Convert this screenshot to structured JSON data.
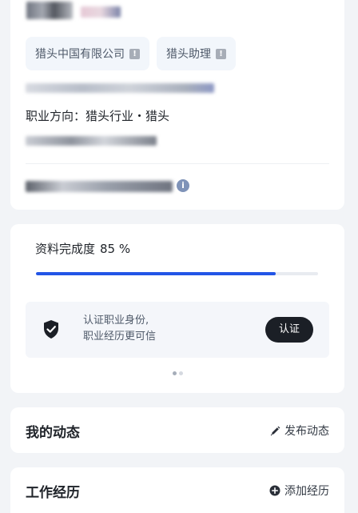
{
  "profile": {
    "tags": [
      {
        "label": "猎头中国有限公司",
        "badge": "!"
      },
      {
        "label": "猎头助理",
        "badge": "!"
      }
    ],
    "career_direction": "职业方向：猎头行业・猎头",
    "info_icon": "i"
  },
  "completion": {
    "label": "资料完成度",
    "percent_text": "85 %",
    "percent": 85
  },
  "verify": {
    "line1": "认证职业身份,",
    "line2": "职业经历更可信",
    "button_label": "认证",
    "pager_total": 2,
    "pager_active": 0
  },
  "moments": {
    "title": "我的动态",
    "action_label": "发布动态"
  },
  "experience": {
    "title": "工作经历",
    "action_label": "添加经历"
  },
  "colors": {
    "accent": "#2255e6",
    "dark_button": "#1b1f26",
    "page_bg": "#f2f4f7"
  },
  "icons": {
    "tag_badge": "warning-badge-icon",
    "info": "info-icon",
    "shield": "shield-check-icon",
    "publish": "pencil-icon",
    "add": "plus-circle-icon"
  }
}
